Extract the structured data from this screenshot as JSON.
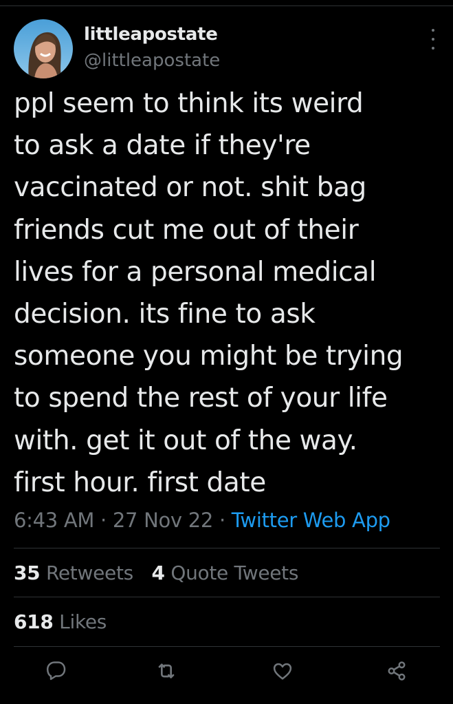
{
  "tweet": {
    "display_name": "littleapostate",
    "handle": "@littleapostate",
    "text": "ppl seem to think its weird\nto ask a date if they're\nvaccinated or not. shit bag\nfriends cut me out of their\nlives for a personal medical\ndecision. its fine to ask\nsomeone you might be trying\nto spend the rest of your life\nwith. get it out of the way.\nfirst hour. first date",
    "time": "6:43 AM",
    "date": "27 Nov 22",
    "separator": "·",
    "source": "Twitter Web App"
  },
  "stats": {
    "retweets_count": "35",
    "retweets_label": "Retweets",
    "quotes_count": "4",
    "quotes_label": "Quote Tweets",
    "likes_count": "618",
    "likes_label": "Likes"
  },
  "icons": {
    "more": "more-vertical-icon",
    "reply": "reply-icon",
    "retweet": "retweet-icon",
    "like": "heart-icon",
    "share": "share-icon"
  },
  "colors": {
    "background": "#000000",
    "text": "#e7e9ea",
    "secondary": "#71767b",
    "accent": "#1d9bf0",
    "divider": "#2f3336"
  }
}
